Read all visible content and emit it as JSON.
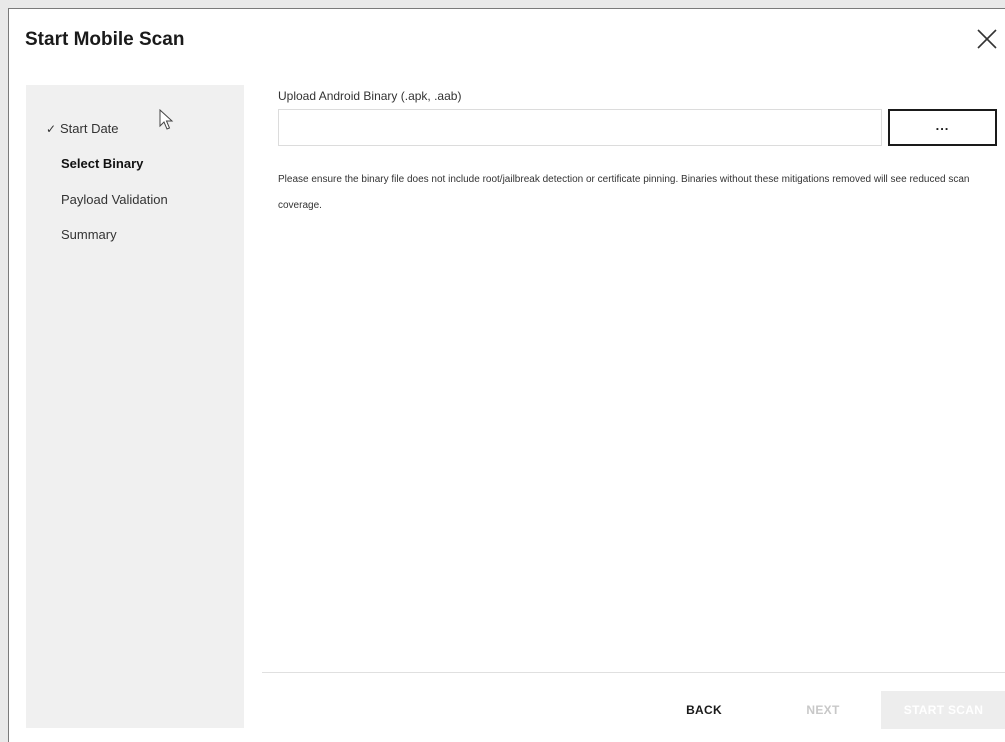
{
  "dialog": {
    "title": "Start Mobile Scan",
    "close_icon": "close-icon"
  },
  "steps": [
    {
      "label": "Start Date",
      "state": "completed",
      "icon": "checkmark-icon"
    },
    {
      "label": "Select Binary",
      "state": "active"
    },
    {
      "label": "Payload Validation",
      "state": "pending"
    },
    {
      "label": "Summary",
      "state": "pending"
    }
  ],
  "upload": {
    "label": "Upload Android Binary (.apk, .aab)",
    "value": "",
    "placeholder": "",
    "browse_label": "..."
  },
  "notice": "Please ensure the binary file does not include root/jailbreak detection or certificate pinning. Binaries without these mitigations removed will see reduced scan coverage.",
  "footer": {
    "back_label": "BACK",
    "next_label": "NEXT",
    "start_label": "START SCAN",
    "next_enabled": false,
    "start_enabled": false
  },
  "colors": {
    "sidebar_bg": "#f0f0f0",
    "disabled_text": "#c8c8c8",
    "disabled_button_bg": "#ededed"
  }
}
